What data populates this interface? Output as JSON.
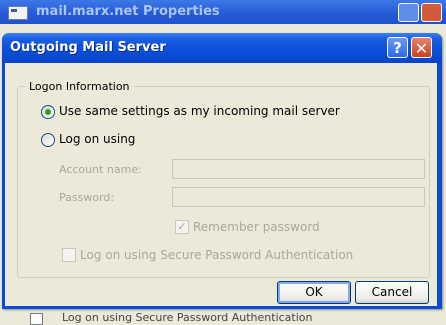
{
  "background_window": {
    "title": "mail.marx.net Properties",
    "bottom_text": "Log on using Secure Password Authentication"
  },
  "dialog": {
    "title": "Outgoing Mail Server",
    "help_symbol": "?",
    "close_symbol": "✕",
    "group_label": "Logon Information",
    "options": {
      "same_settings": "Use same settings as my incoming mail server",
      "log_on_using": "Log on using"
    },
    "account_name_label": "Account name:",
    "password_label": "Password:",
    "account_name_value": "",
    "password_value": "",
    "remember_password": "Remember password",
    "spa": "Log on using Secure Password Authentication",
    "ok": "OK",
    "cancel": "Cancel"
  }
}
